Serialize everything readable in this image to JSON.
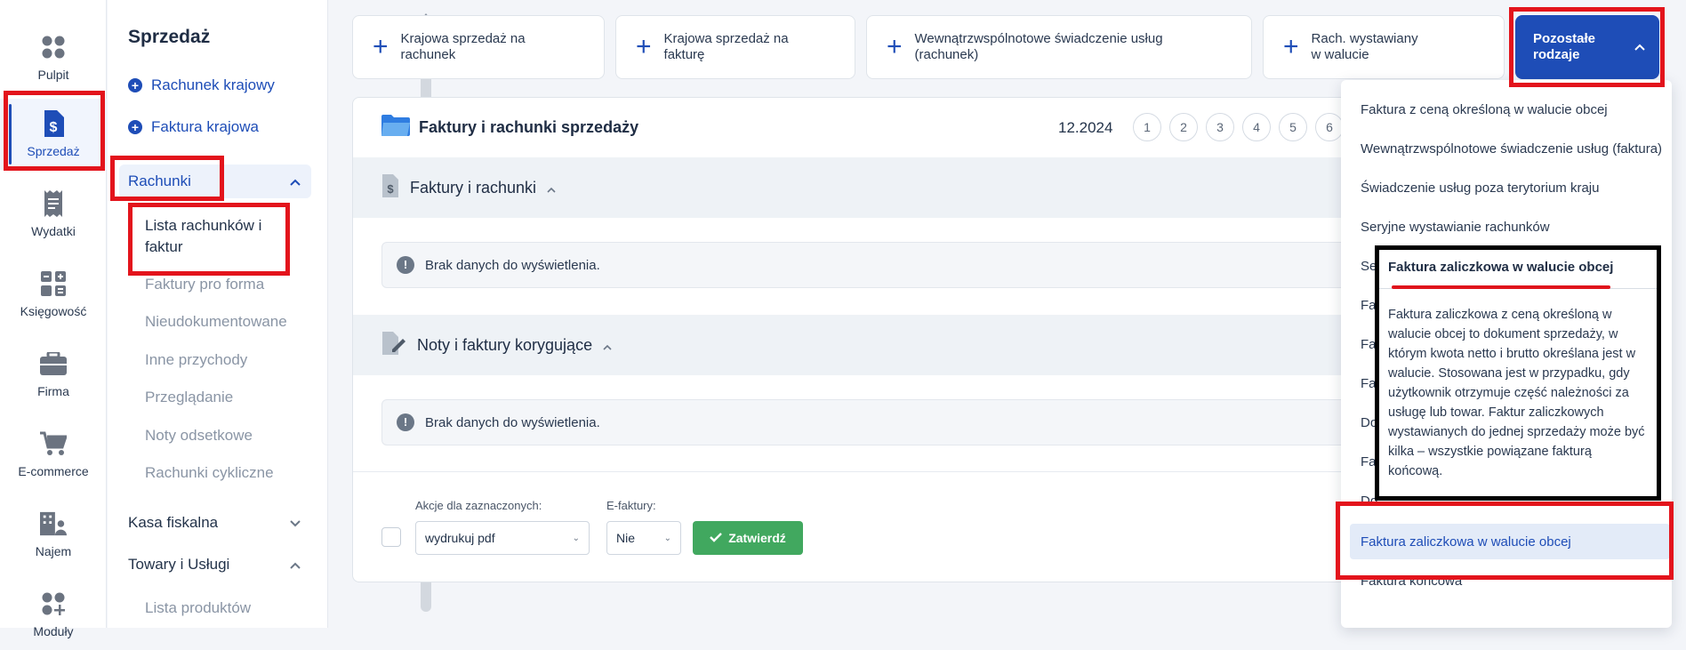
{
  "nav": {
    "items": [
      {
        "label": "Pulpit",
        "icon": "dashboard-icon"
      },
      {
        "label": "Sprzedaż",
        "icon": "invoice-dollar-icon"
      },
      {
        "label": "Wydatki",
        "icon": "receipt-icon"
      },
      {
        "label": "Księgowość",
        "icon": "calculator-icon"
      },
      {
        "label": "Firma",
        "icon": "briefcase-icon"
      },
      {
        "label": "E-commerce",
        "icon": "cart-icon"
      },
      {
        "label": "Najem",
        "icon": "building-icon"
      },
      {
        "label": "Moduły",
        "icon": "modules-icon"
      }
    ]
  },
  "sidepanel": {
    "title": "Sprzedaż",
    "quick_links": [
      "Rachunek krajowy",
      "Faktura krajowa"
    ],
    "group_rachunki": "Rachunki",
    "rachunki_items": [
      "Lista rachunków i faktur",
      "Faktury pro forma",
      "Nieudokumentowane",
      "Inne przychody",
      "Przeglądanie",
      "Noty odsetkowe",
      "Rachunki cykliczne"
    ],
    "group_kasa": "Kasa fiskalna",
    "group_towary": "Towary i Usługi",
    "towary_items": [
      "Lista produktów"
    ]
  },
  "quick_buttons": [
    "Krajowa sprzedaż na rachunek",
    "Krajowa sprzedaż na fakturę",
    "Wewnątrzwspólnotowe świadczenie usług (rachunek)",
    "Rach. wystawiany w walucie"
  ],
  "other_button": "Pozostałe rodzaje",
  "card": {
    "title": "Faktury i rachunki sprzedaży",
    "period": "12.2024",
    "pages": [
      "1",
      "2",
      "3",
      "4",
      "5",
      "6"
    ],
    "section1": "Faktury i rachunki",
    "section2": "Noty i faktury korygujące",
    "empty_text": "Brak danych do wyświetlenia.",
    "actions_label": "Akcje dla zaznaczonych:",
    "actions_value": "wydrukuj pdf",
    "efaktury_label": "E-faktury:",
    "efaktury_value": "Nie",
    "confirm_label": "Zatwierdź"
  },
  "dropdown": {
    "items": [
      "Faktura z ceną określoną w walucie obcej",
      "Wewnątrzwspólnotowe świadczenie usług (faktura)",
      "Świadczenie usług poza terytorium kraju",
      "Seryjne wystawianie rachunków",
      "Se",
      "Fa",
      "Fa",
      "Fa",
      "Do",
      "Fa",
      "Do",
      "Faktura zaliczkowa w walucie obcej",
      "Faktura końcowa"
    ]
  },
  "tooltip": {
    "title": "Faktura zaliczkowa w walucie obcej",
    "body": "Faktura zaliczkowa z ceną określoną w walucie obcej to dokument sprzedaży, w którym kwota netto i brutto określana jest w walucie. Stosowana jest w przypadku, gdy użytkownik otrzymuje część należności za usługę lub towar. Faktur zaliczkowych wystawianych do jednej sprzedaży może być kilka – wszystkie powiązane fakturą końcową."
  },
  "colors": {
    "accent": "#1e4db7",
    "highlight_red": "#e3141c",
    "confirm_green": "#41a85f"
  }
}
